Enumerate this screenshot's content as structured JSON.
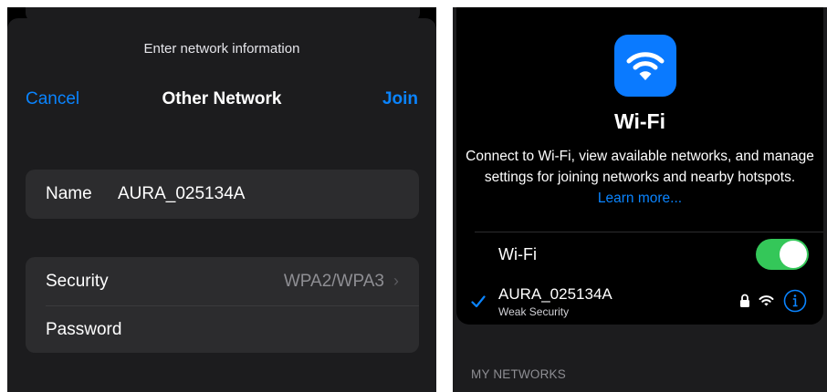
{
  "left": {
    "prompt": "Enter network information",
    "nav": {
      "cancel": "Cancel",
      "title": "Other Network",
      "join": "Join"
    },
    "name_row": {
      "label": "Name",
      "value": "AURA_025134A"
    },
    "security_row": {
      "label": "Security",
      "value": "WPA2/WPA3",
      "chevron": "›"
    },
    "password_row": {
      "label": "Password"
    }
  },
  "right": {
    "app_icon": "wifi-icon",
    "heading": "Wi-Fi",
    "description": "Connect to Wi-Fi, view available networks, and manage settings for joining networks and nearby hotspots.",
    "learn_more": "Learn more...",
    "wifi_toggle": {
      "label": "Wi-Fi",
      "on": true
    },
    "connected_network": {
      "name": "AURA_025134A",
      "subtitle": "Weak Security",
      "icons": [
        "checkmark-icon",
        "lock-icon",
        "wifi-signal-icon",
        "info-icon"
      ]
    },
    "section_header": "MY NETWORKS"
  },
  "colors": {
    "accent": "#0a84ff",
    "toggle_on": "#34c759",
    "app_icon_bg": "#0a7aff",
    "sheet_bg": "#1c1c1e",
    "group_bg": "#2c2c2e"
  }
}
